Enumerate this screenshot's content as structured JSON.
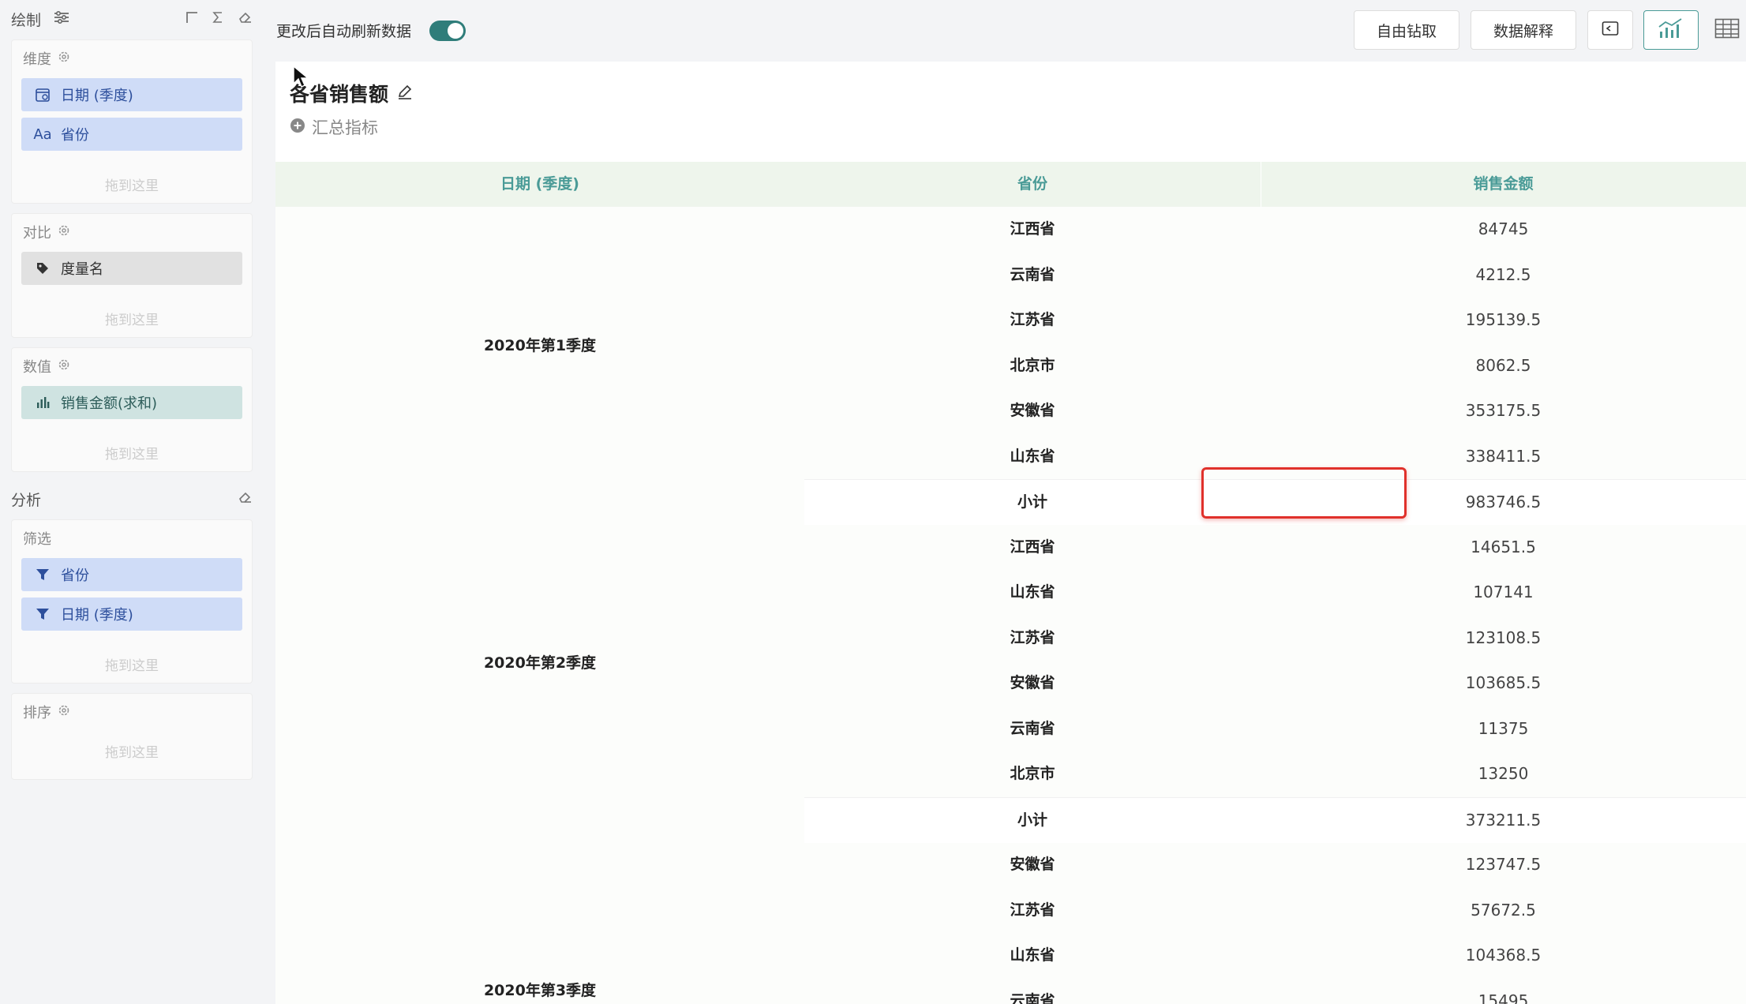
{
  "left_panel": {
    "draw": {
      "title": "绘制"
    },
    "dimension": {
      "title": "维度",
      "items": [
        "日期 (季度)",
        "省份"
      ],
      "drop": "拖到这里"
    },
    "compare": {
      "title": "对比",
      "items": [
        "度量名"
      ],
      "drop": "拖到这里"
    },
    "value": {
      "title": "数值",
      "items": [
        "销售金额(求和)"
      ],
      "drop": "拖到这里"
    },
    "analysis": {
      "title": "分析"
    },
    "filter": {
      "title": "筛选",
      "items": [
        "省份",
        "日期 (季度)"
      ],
      "drop": "拖到这里"
    },
    "sort": {
      "title": "排序",
      "drop": "拖到这里"
    }
  },
  "toolbar": {
    "auto_refresh_label": "更改后自动刷新数据",
    "auto_refresh_on": true,
    "free_drill": "自由钻取",
    "data_explain": "数据解释"
  },
  "chart": {
    "title": "各省销售额",
    "add_metric": "汇总指标"
  },
  "table": {
    "headers": [
      "日期 (季度)",
      "省份",
      "销售金额"
    ],
    "groups": [
      {
        "label": "2020年第1季度",
        "rows": [
          {
            "province": "江西省",
            "amount": "84745"
          },
          {
            "province": "云南省",
            "amount": "4212.5"
          },
          {
            "province": "江苏省",
            "amount": "195139.5"
          },
          {
            "province": "北京市",
            "amount": "8062.5"
          },
          {
            "province": "安徽省",
            "amount": "353175.5"
          },
          {
            "province": "山东省",
            "amount": "338411.5"
          },
          {
            "province": "小计",
            "amount": "983746.5"
          }
        ]
      },
      {
        "label": "2020年第2季度",
        "rows": [
          {
            "province": "江西省",
            "amount": "14651.5"
          },
          {
            "province": "山东省",
            "amount": "107141"
          },
          {
            "province": "江苏省",
            "amount": "123108.5"
          },
          {
            "province": "安徽省",
            "amount": "103685.5"
          },
          {
            "province": "云南省",
            "amount": "11375"
          },
          {
            "province": "北京市",
            "amount": "13250"
          },
          {
            "province": "小计",
            "amount": "373211.5"
          }
        ]
      },
      {
        "label": "2020年第3季度",
        "rows": [
          {
            "province": "安徽省",
            "amount": "123747.5"
          },
          {
            "province": "江苏省",
            "amount": "57672.5"
          },
          {
            "province": "山东省",
            "amount": "104368.5"
          },
          {
            "province": "云南省",
            "amount": "15495"
          }
        ]
      }
    ]
  },
  "colors": {
    "accent": "#4a9b97",
    "toggle": "#2f7d7a",
    "highlight": "#e0312b"
  }
}
